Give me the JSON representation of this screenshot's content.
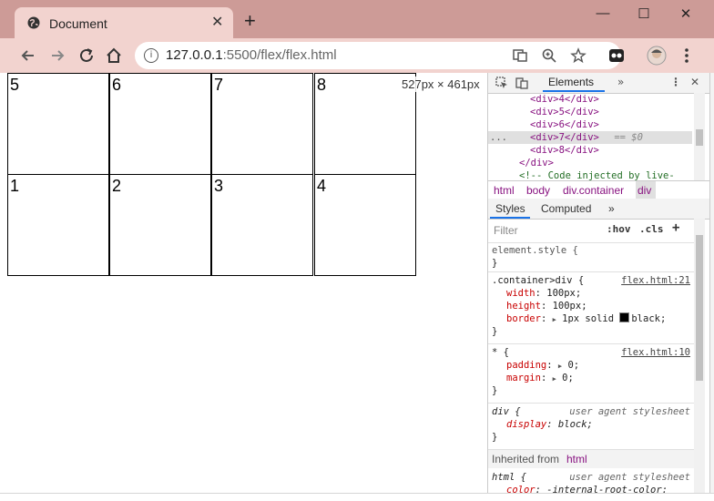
{
  "browser": {
    "tab_title": "Document",
    "tab_close": "✕",
    "new_tab": "+",
    "minimize": "—",
    "maximize": "☐",
    "close": "✕",
    "url_host": "127.0.0.1",
    "url_rest": ":5500/flex/flex.html"
  },
  "page": {
    "boxes_top": [
      "5",
      "6",
      "7",
      "8"
    ],
    "boxes_bottom": [
      "1",
      "2",
      "3",
      "4"
    ],
    "size_overlay": "527px × 461px"
  },
  "devtools": {
    "tab_elements": "Elements",
    "more_tabs": "»",
    "dom_lines": [
      "<div>4</div>",
      "<div>5</div>",
      "<div>6</div>",
      "<div>7</div>",
      "<div>8</div>",
      "</div>",
      "<!-- Code injected by live-"
    ],
    "selected_suffix": " == $0",
    "ellipsis": "...",
    "breadcrumbs": [
      "html",
      "body",
      "div.container",
      "div"
    ],
    "styles_tabs": [
      "Styles",
      "Computed",
      "»"
    ],
    "filter_placeholder": "Filter",
    "filter_hov": ":hov",
    "filter_cls": ".cls",
    "filter_add": "+",
    "rules": {
      "element_style": {
        "selector": "element.style {",
        "close": "}"
      },
      "container": {
        "selector": ".container>div {",
        "source": "flex.html:21",
        "width": {
          "prop": "width",
          "value": "100px;"
        },
        "height": {
          "prop": "height",
          "value": "100px;"
        },
        "border": {
          "prop": "border",
          "value": "1px solid ",
          "color": "black;"
        },
        "close": "}"
      },
      "universal": {
        "selector": "* {",
        "source": "flex.html:10",
        "padding": {
          "prop": "padding",
          "value": "0;"
        },
        "margin": {
          "prop": "margin",
          "value": "0;"
        },
        "close": "}"
      },
      "div_ua": {
        "selector": "div {",
        "source": "user agent stylesheet",
        "display": {
          "prop": "display",
          "value": "block;"
        },
        "close": "}"
      },
      "inherited_label": "Inherited from",
      "inherited_tag": "html",
      "html_ua": {
        "selector": "html {",
        "source": "user agent stylesheet",
        "color": {
          "prop": "color",
          "value": "-internal-root-color;"
        }
      }
    }
  }
}
